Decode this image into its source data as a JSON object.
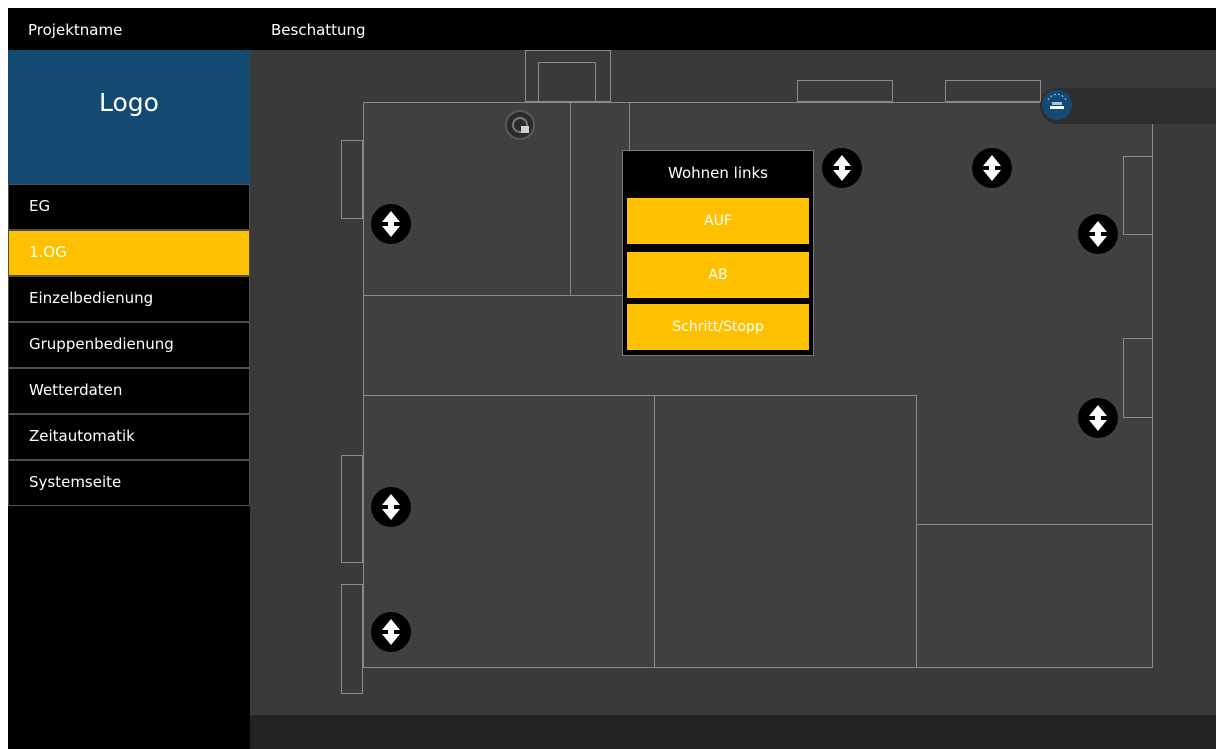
{
  "header": {
    "project_name": "Projektname",
    "page_title": "Beschattung"
  },
  "sidebar": {
    "logo": "Logo",
    "items": [
      {
        "label": "EG",
        "active": false
      },
      {
        "label": "1.OG",
        "active": true
      },
      {
        "label": "Einzelbedienung",
        "active": false
      },
      {
        "label": "Gruppenbedienung",
        "active": false
      },
      {
        "label": "Wetterdaten",
        "active": false
      },
      {
        "label": "Zeitautomatik",
        "active": false
      },
      {
        "label": "Systemseite",
        "active": false
      }
    ]
  },
  "popup": {
    "title": "Wohnen links",
    "buttons": {
      "up": "AUF",
      "down": "AB",
      "step": "Schritt/Stopp"
    }
  },
  "colors": {
    "accent": "#ffc000",
    "logo_bg": "#134a72",
    "floor_bg": "#3a3a3a",
    "room_line": "#8a8a8a"
  },
  "icons": {
    "shade": "up-down-arrow-icon",
    "camera": "camera-icon",
    "weather": "weather-icon"
  }
}
